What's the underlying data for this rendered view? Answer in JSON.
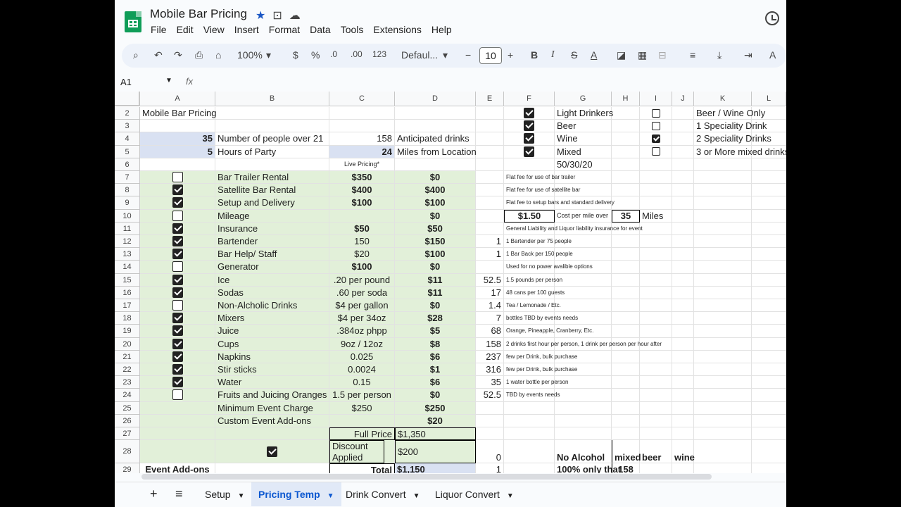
{
  "app": {
    "title": "Mobile Bar Pricing",
    "menu": [
      "File",
      "Edit",
      "View",
      "Insert",
      "Format",
      "Data",
      "Tools",
      "Extensions",
      "Help"
    ]
  },
  "toolbar": {
    "zoom": "100%",
    "currency": "$",
    "percent": "%",
    "dec_decrease": ".0",
    "dec_increase": ".00",
    "number_format": "123",
    "font": "Defaul...",
    "font_size": "10",
    "bold": "B",
    "italic": "I",
    "strike": "S",
    "text_color": "A"
  },
  "formula_bar": {
    "cell_ref": "A1",
    "fx": "fx"
  },
  "columns": [
    "A",
    "B",
    "C",
    "D",
    "E",
    "F",
    "G",
    "H",
    "I",
    "J",
    "K",
    "L"
  ],
  "rows": [
    "2",
    "3",
    "4",
    "5",
    "6",
    "7",
    "8",
    "9",
    "10",
    "11",
    "12",
    "13",
    "14",
    "15",
    "16",
    "17",
    "18",
    "19",
    "20",
    "21",
    "22",
    "23",
    "24",
    "25",
    "26",
    "27",
    "28",
    "29"
  ],
  "cells": {
    "a2": "Mobile Bar Pricing",
    "a4": "35",
    "b4": "Number of people over 21",
    "c4": "158",
    "d4": "Anticipated drinks",
    "a5": "5",
    "b5": "Hours of Party",
    "c5": "24",
    "d5": "Miles from Location",
    "c6": "Live Pricing*",
    "g2": "Light Drinkers",
    "g3": "Beer",
    "g4": "Wine",
    "g5": "Mixed",
    "g6": "50/30/20",
    "k2": "Beer / Wine Only",
    "k3": "1 Speciality Drink",
    "k4": "2 Speciality Drinks",
    "k5": "3 or More mixed drinks",
    "g10_price": "$1.50",
    "g10_label": "Cost per mile over",
    "h10": "35",
    "i10": "Miles",
    "c27": "Full Price",
    "d27": "$1,350",
    "c28": "Discount Applied",
    "d28": "$200",
    "e28": "0",
    "g28": "No Alcohol",
    "h28": "mixed",
    "i28": "beer",
    "j28": "wine",
    "a29": "Event Add-ons",
    "c29": "Total",
    "d29": "$1,150",
    "e29": "1",
    "g29": "100% only that",
    "h29": "158"
  },
  "items": [
    {
      "row": "7",
      "checked": false,
      "name": "Bar Trailer Rental",
      "unit": "$350",
      "unit_bold": true,
      "total": "$0",
      "qty": "",
      "note": "Flat fee for use of bar trailer"
    },
    {
      "row": "8",
      "checked": true,
      "name": "Satellite  Bar Rental",
      "unit": "$400",
      "unit_bold": true,
      "total": "$400",
      "qty": "",
      "note": "Flat fee for use of satellite bar"
    },
    {
      "row": "9",
      "checked": true,
      "name": "Setup and Delivery",
      "unit": "$100",
      "unit_bold": true,
      "total": "$100",
      "qty": "",
      "note": "Flat fee to setup bars and standard delivery"
    },
    {
      "row": "10",
      "checked": false,
      "name": "Mileage",
      "unit": "",
      "unit_bold": false,
      "total": "$0",
      "qty": "",
      "note": ""
    },
    {
      "row": "11",
      "checked": true,
      "name": "Insurance",
      "unit": "$50",
      "unit_bold": true,
      "total": "$50",
      "qty": "",
      "note": "General Liability and Liquor liability insurance for event"
    },
    {
      "row": "12",
      "checked": true,
      "name": "Bartender",
      "unit": "150",
      "unit_bold": false,
      "total": "$150",
      "qty": "1",
      "note": "1 Bartender per 75 people"
    },
    {
      "row": "13",
      "checked": true,
      "name": "Bar Help/ Staff",
      "unit": "$20",
      "unit_bold": false,
      "total": "$100",
      "qty": "1",
      "note": "1 Bar Back per 150 people"
    },
    {
      "row": "14",
      "checked": false,
      "name": "Generator",
      "unit": "$100",
      "unit_bold": true,
      "total": "$0",
      "qty": "",
      "note": "Used for no power avalible options"
    },
    {
      "row": "15",
      "checked": true,
      "name": "Ice",
      "unit": ".20 per pound",
      "unit_bold": false,
      "total": "$11",
      "qty": "52.5",
      "note": "1.5 pounds per person"
    },
    {
      "row": "16",
      "checked": true,
      "name": "Sodas",
      "unit": ".60 per soda",
      "unit_bold": false,
      "total": "$11",
      "qty": "17",
      "note": "48 cans per 100 guests"
    },
    {
      "row": "17",
      "checked": false,
      "name": "Non-Alcholic Drinks",
      "unit": "$4 per gallon",
      "unit_bold": false,
      "total": "$0",
      "qty": "1.4",
      "note": "Tea / Lemonade / Etc."
    },
    {
      "row": "18",
      "checked": true,
      "name": "Mixers",
      "unit": "$4 per 34oz",
      "unit_bold": false,
      "total": "$28",
      "qty": "7",
      "note": "bottles TBD by events needs"
    },
    {
      "row": "19",
      "checked": true,
      "name": "Juice",
      "unit": ".384oz phpp",
      "unit_bold": false,
      "total": "$5",
      "qty": "68",
      "note": "Orange, Pineapple, Cranberry, Etc."
    },
    {
      "row": "20",
      "checked": true,
      "name": "Cups",
      "unit": "9oz / 12oz",
      "unit_bold": false,
      "total": "$8",
      "qty": "158",
      "note": "2 drinks first hour per person, 1 drink per person per hour after"
    },
    {
      "row": "21",
      "checked": true,
      "name": "Napkins",
      "unit": "0.025",
      "unit_bold": false,
      "total": "$6",
      "qty": "237",
      "note": "few per Drink, bulk purchase"
    },
    {
      "row": "22",
      "checked": true,
      "name": "Stir sticks",
      "unit": "0.0024",
      "unit_bold": false,
      "total": "$1",
      "qty": "316",
      "note": "few per Drink, bulk purchase"
    },
    {
      "row": "23",
      "checked": true,
      "name": "Water",
      "unit": "0.15",
      "unit_bold": false,
      "total": "$6",
      "qty": "35",
      "note": "1 water bottle per person"
    },
    {
      "row": "24",
      "checked": false,
      "name": "Fruits and Juicing Oranges",
      "unit": "1.5 per person",
      "unit_bold": false,
      "total": "$0",
      "qty": "52.5",
      "note": "TBD by events needs"
    },
    {
      "row": "25",
      "checked": null,
      "name": "Minimum Event Charge",
      "unit": "$250",
      "unit_bold": false,
      "total": "$250",
      "qty": "",
      "note": ""
    },
    {
      "row": "26",
      "checked": null,
      "name": "Custom Event Add-ons",
      "unit": "",
      "unit_bold": false,
      "total": "$20",
      "qty": "",
      "note": ""
    }
  ],
  "checks_f": [
    true,
    true,
    true,
    true
  ],
  "checks_i": [
    false,
    false,
    true,
    false
  ],
  "check_b28": true,
  "tabs": [
    "Setup",
    "Pricing Temp",
    "Drink Convert",
    "Liquor Convert"
  ],
  "active_tab": "Pricing Temp"
}
